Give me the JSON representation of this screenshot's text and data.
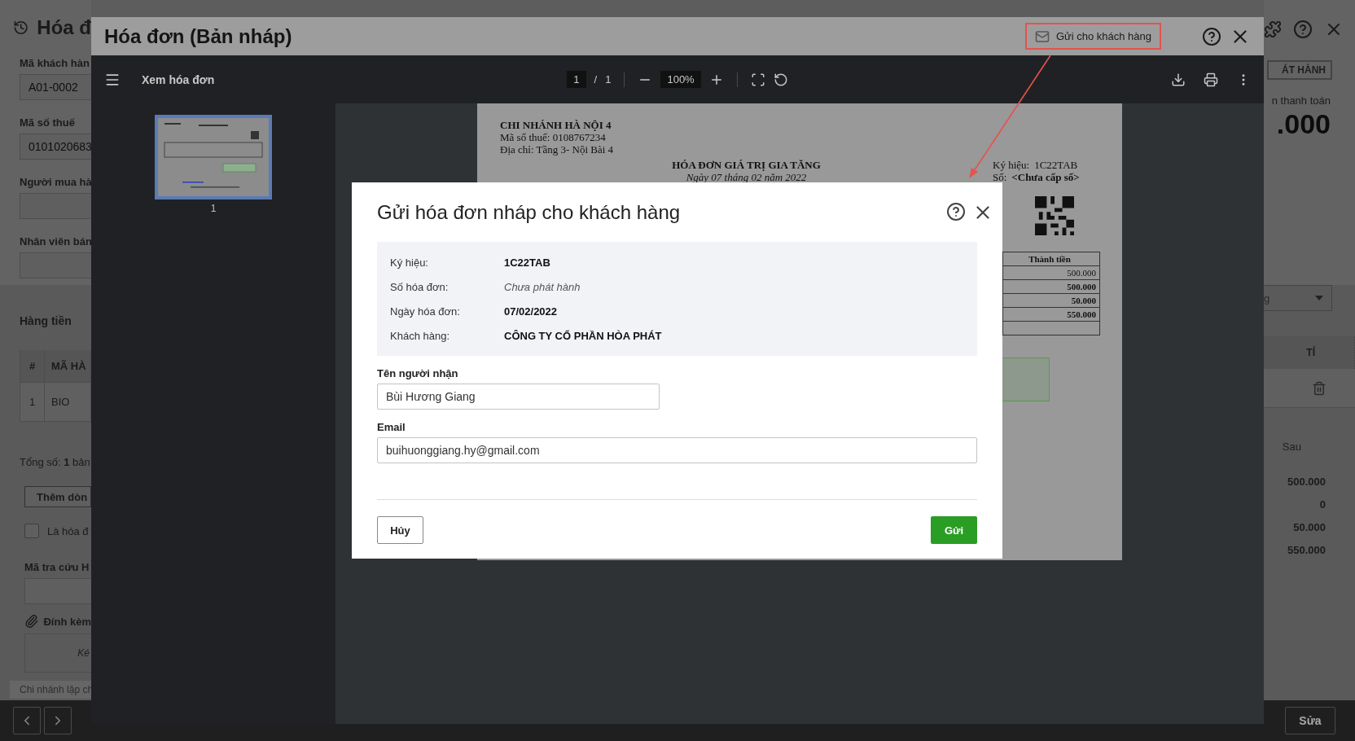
{
  "background_page": {
    "title": "Hóa đ",
    "fields": [
      {
        "label": "Mã khách hàn",
        "value": "A01-0002"
      },
      {
        "label": "Mã số thuế",
        "value": "0101020683"
      },
      {
        "label": "Người mua hà"
      },
      {
        "label": "Nhân viên bán"
      }
    ],
    "section_title": "Hàng tiền",
    "table": {
      "columns": [
        "#",
        "MÃ HÀ"
      ],
      "rows": [
        [
          "1",
          "BIO"
        ]
      ]
    },
    "total": "Tổng số: **1** bản",
    "add_row_button": "Thêm dòn",
    "checkbox": {
      "label": "Là hóa đ",
      "checked": false
    },
    "lookup_label": "Mã tra cứu H",
    "attach_label": "Đính kèm",
    "dropzone_hint": "Ké",
    "status_bar": "Chi nhánh lập ch",
    "issue_button": "ÁT HÀNH",
    "amount_label": "n thanh toán",
    "amount": ".000",
    "dropdown": "g",
    "column": "TỈ",
    "summary_label": "Sau",
    "summary_values": [
      "500.000",
      "0",
      "50.000",
      "550.000"
    ],
    "edit_button": "Sửa"
  },
  "viewer": {
    "title": "Hóa đơn (Bản nháp)",
    "send_button": "Gửi cho khách hàng",
    "toolbar": {
      "title": "Xem hóa đơn",
      "page": "1",
      "separator": "/",
      "page_count": "1",
      "zoom": "100%"
    },
    "thumbnails": [
      {
        "label": "1",
        "selected": true
      }
    ],
    "document": {
      "seller": "CHI NHÁNH HÀ NỘI 4",
      "tax_code": "Mã số thuế: 0108767234",
      "address": "Địa chỉ: Tầng 3- Nội Bài 4",
      "title": "HÓA ĐƠN GIÁ TRỊ GIA TĂNG",
      "date": "Ngày 07 tháng 02 năm 2022",
      "symbol_label": "Ký hiệu:",
      "symbol": "1C22TAB",
      "number_label": "Số:",
      "number": "<Chưa cấp số>",
      "amount_header": "Thành tiền",
      "amounts": [
        {
          "value": "500.000",
          "bold": false
        },
        {
          "value": "500.000",
          "bold": true
        },
        {
          "value": "50.000",
          "bold": true
        },
        {
          "value": "550.000",
          "bold": true
        }
      ]
    }
  },
  "dialog": {
    "title": "Gửi hóa đơn nháp cho khách hàng",
    "info": [
      {
        "label": "Ký hiệu:",
        "value": "1C22TAB",
        "kind": "bold"
      },
      {
        "label": "Số hóa đơn:",
        "value": "Chưa phát hành",
        "kind": "italic"
      },
      {
        "label": "Ngày hóa đơn:",
        "value": "07/02/2022",
        "kind": "bold"
      },
      {
        "label": "Khách hàng:",
        "value": "CÔNG TY CỔ PHẦN HÒA PHÁT",
        "kind": "bold"
      }
    ],
    "recipient": {
      "label": "Tên người nhận",
      "value": "Bùi Hương Giang"
    },
    "email": {
      "label": "Email",
      "value": "buihuonggiang.hy@gmail.com"
    },
    "cancel_button": "Hủy",
    "send_button": "Gửi"
  }
}
